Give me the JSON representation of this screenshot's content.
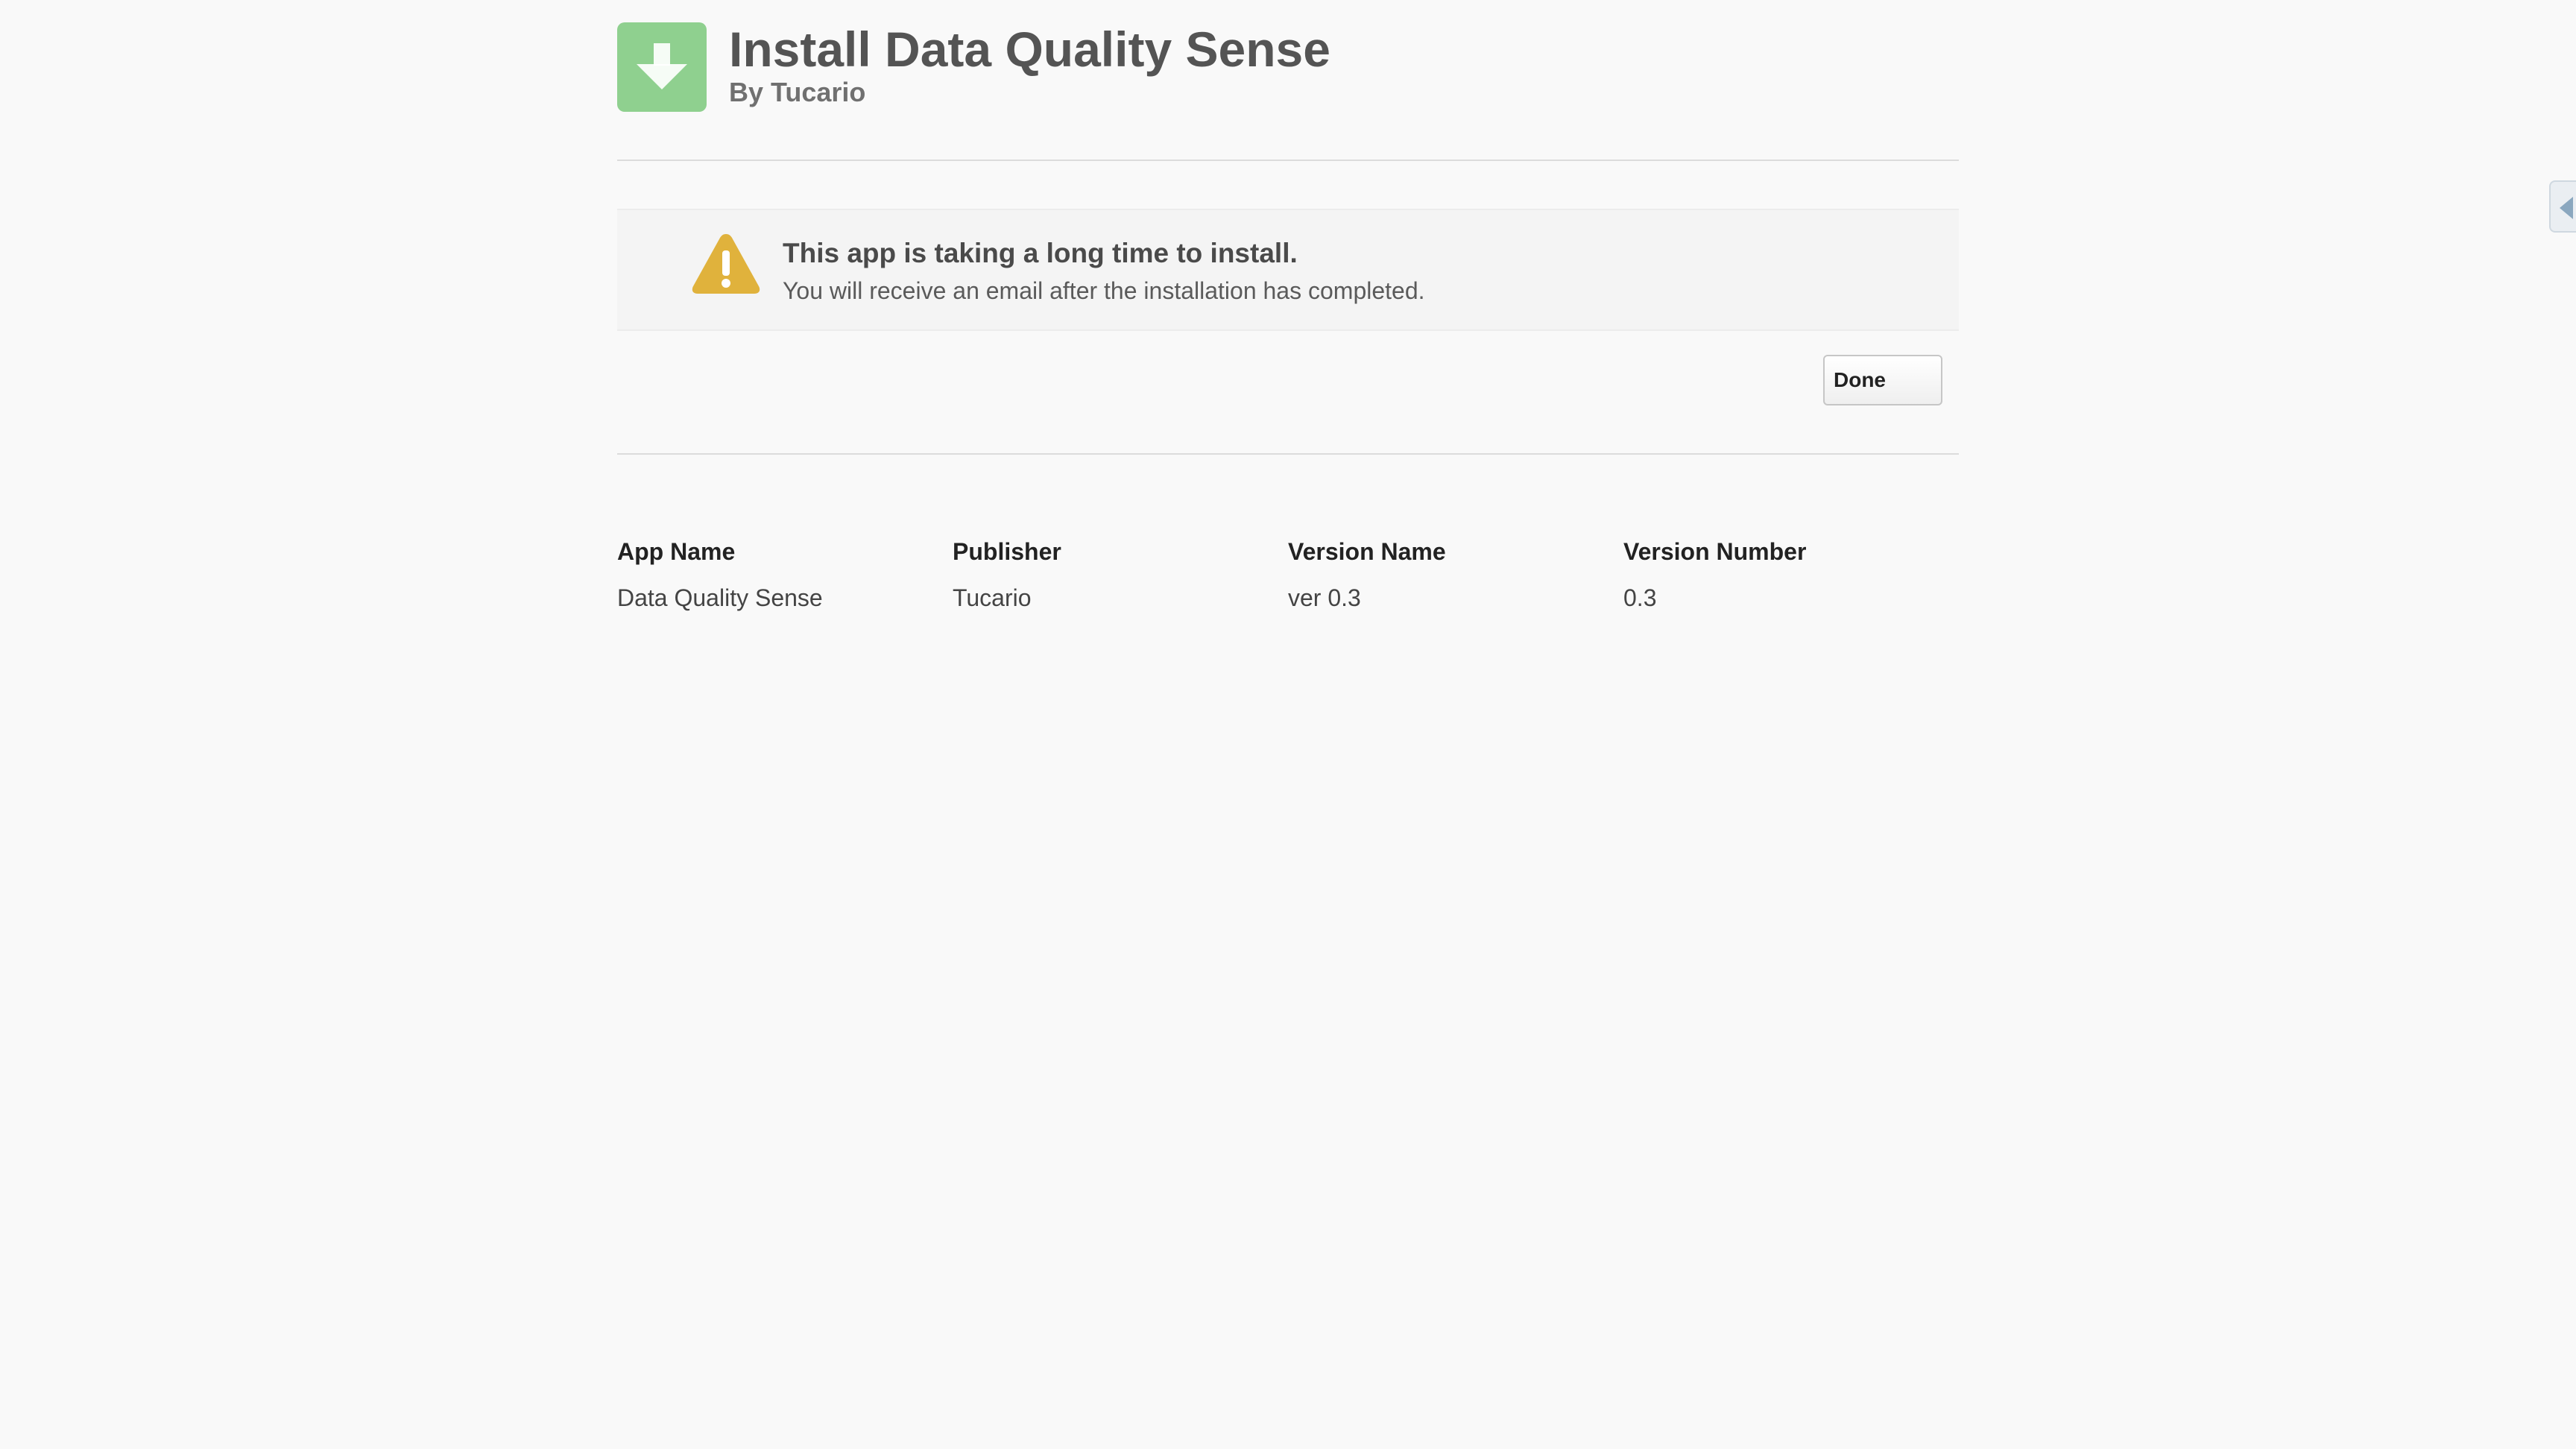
{
  "header": {
    "title": "Install Data Quality Sense",
    "subtitle": "By Tucario",
    "icon": "download-arrow-icon",
    "icon_color": "#8fd08f"
  },
  "notice": {
    "icon": "warning-icon",
    "icon_color": "#e0b23c",
    "title": "This app is taking a long time to install.",
    "text": "You will receive an email after the installation has completed."
  },
  "actions": {
    "done_label": "Done"
  },
  "app_info": {
    "columns": [
      "App Name",
      "Publisher",
      "Version Name",
      "Version Number"
    ],
    "values": [
      "Data Quality Sense",
      "Tucario",
      "ver 0.3",
      "0.3"
    ]
  },
  "side_tab": {
    "icon": "chevron-left-icon"
  }
}
